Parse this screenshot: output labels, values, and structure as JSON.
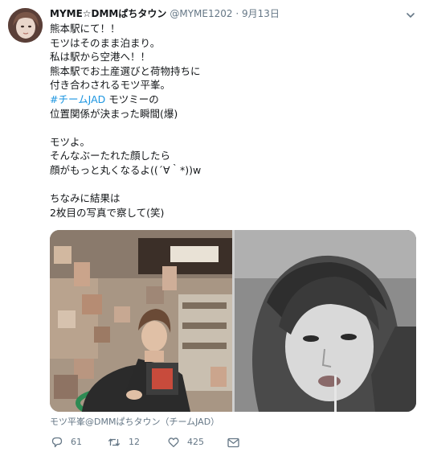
{
  "tweet": {
    "author_name": "MYME☆DMMぱちタウン",
    "handle": "@MYME1202",
    "separator": "·",
    "date": "9月13日",
    "lines": [
      {
        "type": "text",
        "text": "熊本駅にて！！"
      },
      {
        "type": "text",
        "text": "モツはそのまま泊まり。"
      },
      {
        "type": "text",
        "text": "私は駅から空港へ！！"
      },
      {
        "type": "text",
        "text": "熊本駅でお土産選びと荷物持ちに"
      },
      {
        "type": "text",
        "text": "付き合わされるモツ平峯。"
      },
      {
        "type": "hashtag",
        "hashtag": "#チームJAD",
        "text": " モツミーの"
      },
      {
        "type": "text",
        "text": "位置関係が決まった瞬間(爆)"
      },
      {
        "type": "blank"
      },
      {
        "type": "text",
        "text": "モツよ。"
      },
      {
        "type": "text",
        "text": "そんなぶーたれた顔したら"
      },
      {
        "type": "text",
        "text": "顔がもっと丸くなるよ((´∀｀*))w"
      },
      {
        "type": "blank"
      },
      {
        "type": "text",
        "text": "ちなみに結果は"
      },
      {
        "type": "text",
        "text": "2枚目の写真で察して(笑)"
      }
    ],
    "media_attribution": "モツ平峯@DMMぱちタウン（チームJAD）",
    "actions": {
      "reply_count": "61",
      "retweet_count": "12",
      "like_count": "425"
    },
    "icons": {
      "avatar": "avatar-photo",
      "caret": "chevron-down-icon",
      "reply": "reply-icon",
      "retweet": "retweet-icon",
      "like": "heart-icon",
      "dm": "envelope-icon"
    },
    "colors": {
      "text": "#14171a",
      "muted": "#657786",
      "link": "#1b95e0"
    }
  }
}
